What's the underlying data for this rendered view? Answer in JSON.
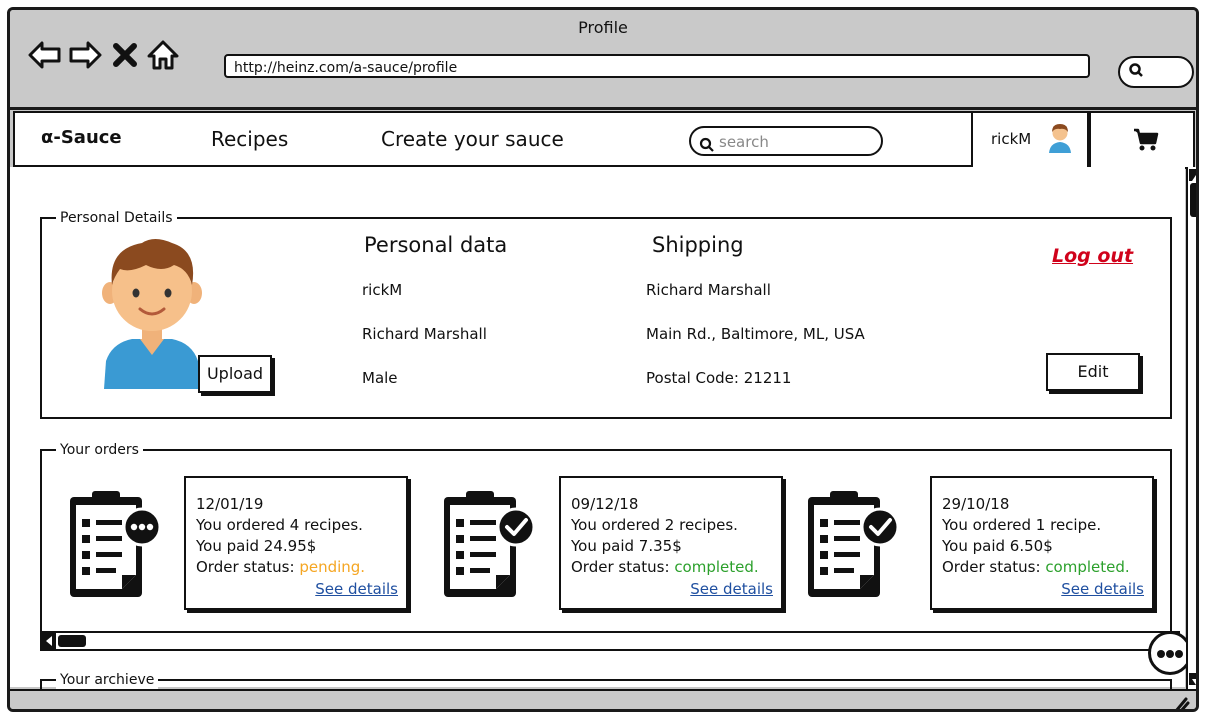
{
  "window": {
    "title": "Profile"
  },
  "browser": {
    "url": "http://heinz.com/a-sauce/profile"
  },
  "menu": {
    "brand": "α-Sauce",
    "items": [
      "Recipes",
      "Create your sauce"
    ],
    "search_placeholder": "search",
    "username": "rickM"
  },
  "personal_details": {
    "legend": "Personal Details",
    "upload_label": "Upload",
    "personal_heading": "Personal data",
    "shipping_heading": "Shipping",
    "personal": [
      "rickM",
      "Richard Marshall",
      "Male"
    ],
    "shipping": [
      "Richard Marshall",
      "Main Rd., Baltimore, ML, USA",
      "Postal Code: 21211"
    ],
    "logout_label": "Log out",
    "edit_label": "Edit"
  },
  "orders": {
    "legend": "Your orders",
    "items": [
      {
        "date": "12/01/19",
        "summary": "You ordered 4 recipes.",
        "paid": "You paid 24.95$",
        "status_label": "Order status: ",
        "status": "pending.",
        "status_kind": "pending",
        "link": "See details"
      },
      {
        "date": "09/12/18",
        "summary": "You ordered 2 recipes.",
        "paid": "You paid 7.35$",
        "status_label": "Order status: ",
        "status": "completed.",
        "status_kind": "completed",
        "link": "See details"
      },
      {
        "date": "29/10/18",
        "summary": "You ordered 1 recipe.",
        "paid": "You paid 6.50$",
        "status_label": "Order status: ",
        "status": "completed.",
        "status_kind": "completed",
        "link": "See details"
      }
    ]
  },
  "archive": {
    "legend": "Your archieve"
  },
  "colors": {
    "pending": "#f5a623",
    "completed": "#2ca02c",
    "logout": "#d0021b",
    "link": "#1f4fa0"
  }
}
